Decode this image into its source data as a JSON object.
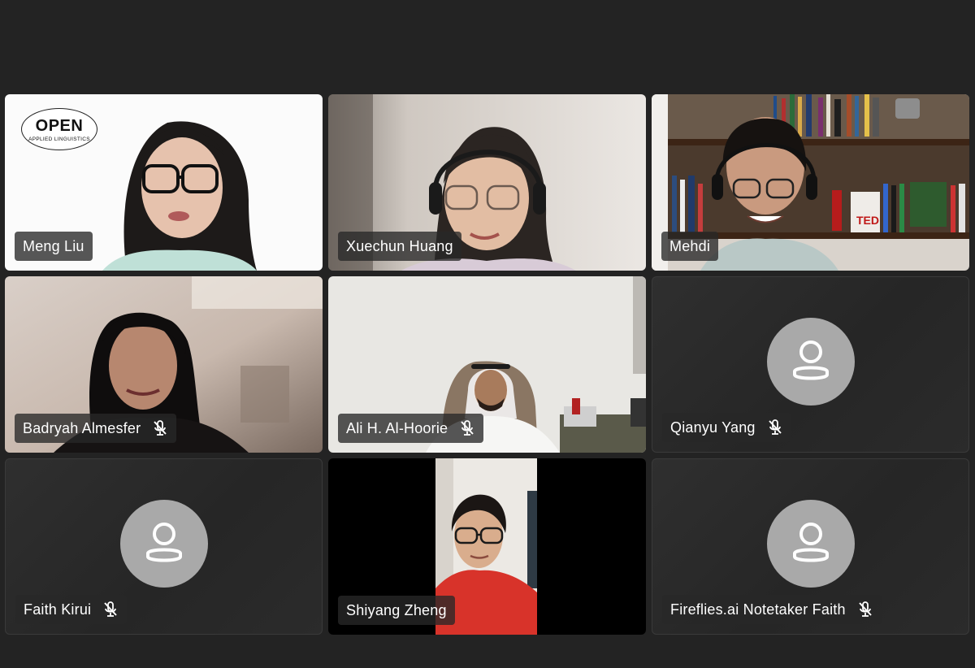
{
  "colors": {
    "background": "#232323",
    "empty_tile": "#2b2b2b",
    "avatar_bg": "#a9a9a9",
    "name_tag_bg": "#282828",
    "text": "#ffffff"
  },
  "logo": {
    "main_text": "OPEN",
    "sub_text": "APPLIED LINGUISTICS"
  },
  "participants": [
    {
      "name": "Meng Liu",
      "muted": false,
      "video": true
    },
    {
      "name": "Xuechun Huang",
      "muted": false,
      "video": true
    },
    {
      "name": "Mehdi",
      "muted": false,
      "video": true
    },
    {
      "name": "Badryah Almesfer",
      "muted": true,
      "video": true
    },
    {
      "name": "Ali H. Al-Hoorie",
      "muted": true,
      "video": true
    },
    {
      "name": "Qianyu Yang",
      "muted": true,
      "video": false,
      "avatar_icon": "user-placeholder-icon"
    },
    {
      "name": "Faith Kirui",
      "muted": true,
      "video": false,
      "avatar_icon": "user-placeholder-icon"
    },
    {
      "name": "Shiyang Zheng",
      "muted": false,
      "video": true
    },
    {
      "name": "Fireflies.ai Notetaker Faith",
      "muted": true,
      "video": false,
      "avatar_icon": "user-placeholder-icon"
    }
  ]
}
